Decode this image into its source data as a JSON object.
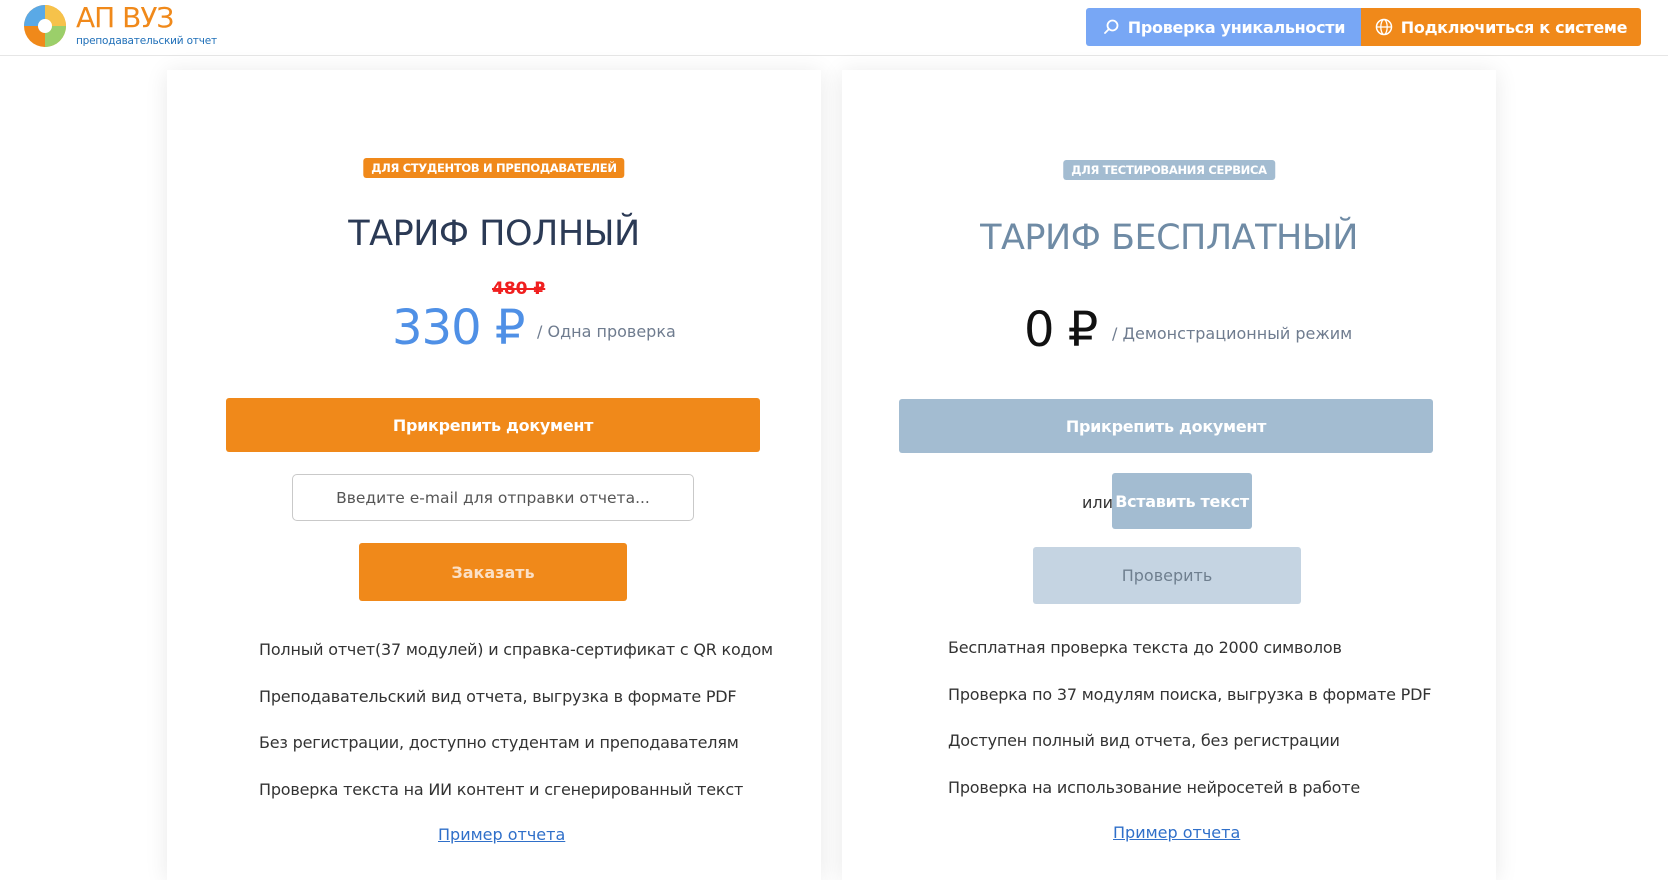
{
  "header": {
    "logo_title": "АП ВУЗ",
    "logo_subtitle": "преподавательский отчет",
    "check_button": "Проверка уникальности",
    "connect_button": "Подключиться к системе"
  },
  "plans": {
    "full": {
      "badge": "ДЛЯ СТУДЕНТОВ И ПРЕПОДАВАТЕЛЕЙ",
      "title": "ТАРИФ ПОЛНЫЙ",
      "old_price": "480 ₽",
      "price": "330 ₽",
      "per": "/ Одна проверка",
      "attach_button": "Прикрепить документ",
      "email_placeholder": "Введите e-mail для отправки отчета...",
      "order_button": "Заказать",
      "features": [
        "Полный отчет(37 модулей) и справка-сертификат с QR кодом",
        "Преподавательский вид отчета, выгрузка в формате PDF",
        "Без регистрации, доступно студентам и преподавателям",
        "Проверка текста на ИИ контент и сгенерированный текст"
      ],
      "sample_link": "Пример отчета"
    },
    "free": {
      "badge": "ДЛЯ ТЕСТИРОВАНИЯ СЕРВИСА",
      "title": "ТАРИФ БЕСПЛАТНЫЙ",
      "price": "0 ₽",
      "per": "/ Демонстрационный режим",
      "attach_button": "Прикрепить документ",
      "or_text": "или",
      "paste_button": "Вставить текст",
      "verify_button": "Проверить",
      "features": [
        "Бесплатная проверка текста до 2000 символов",
        "Проверка по 37 модулям поиска, выгрузка в формате PDF",
        "Доступен полный вид отчета, без регистрации",
        "Проверка на использование нейросетей в работе"
      ],
      "sample_link": "Пример отчета"
    }
  },
  "colors": {
    "accent_orange": "#f0891a",
    "accent_blue": "#78a7f5",
    "muted_blue": "#a3bcd1",
    "title_dark": "#2b3a55"
  },
  "icons": [
    "logo-icon",
    "search-icon",
    "globe-icon"
  ]
}
